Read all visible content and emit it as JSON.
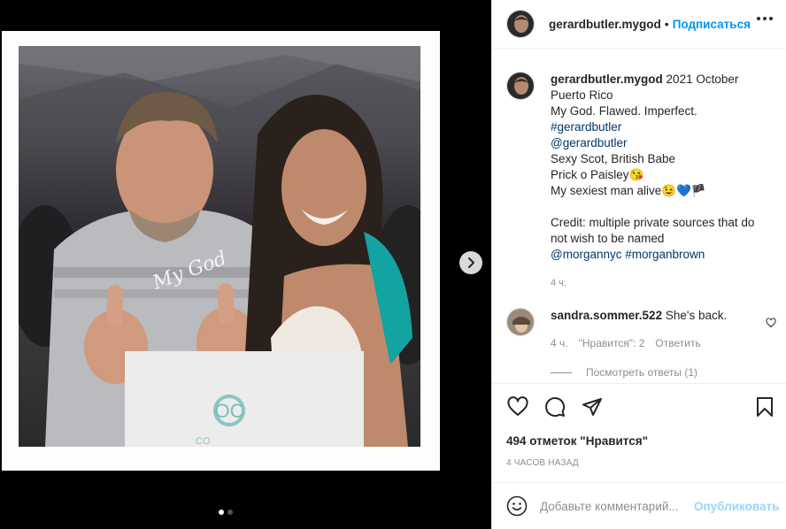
{
  "post": {
    "username": "gerardbutler.mygod",
    "follow_label": "Подписаться",
    "header_separator": "•",
    "caption_lines": [
      {
        "text": "2021 October",
        "style": "plain"
      },
      {
        "text": "Puerto Rico",
        "style": "plain"
      },
      {
        "text": "My God. Flawed. Imperfect.",
        "style": "plain"
      },
      {
        "text": "#gerardbutler",
        "style": "tag"
      },
      {
        "text": "@gerardbutler",
        "style": "tag"
      },
      {
        "text": "Sexy Scot, British Babe",
        "style": "plain"
      },
      {
        "text": "Prick o Paisley😘",
        "style": "plain"
      },
      {
        "text": "My sexiest man alive😉💙🏴",
        "style": "plain"
      },
      {
        "text": "",
        "style": "plain"
      },
      {
        "text": "Credit: multiple private sources that do not wish to be named",
        "style": "plain"
      }
    ],
    "credit_tags": [
      "@morgannyc",
      "#morganbrown"
    ],
    "caption_time": "4 ч.",
    "photo_text": "My God",
    "photo_sign_text": "OC",
    "photo_sign_sub": "CO"
  },
  "comment": {
    "username": "sandra.sommer.522",
    "text": "She's back.",
    "time": "4 ч.",
    "likes_label": "\"Нравится\": 2",
    "reply_label": "Ответить",
    "view_replies": "Посмотреть ответы (1)"
  },
  "actions": {
    "likes": "494 отметок \"Нравится\"",
    "time_ago": "4 ЧАСОВ НАЗАД"
  },
  "add_comment": {
    "placeholder": "Добавьте комментарий...",
    "publish_label": "Опубликовать"
  },
  "carousel": {
    "total": 2,
    "current": 1
  },
  "colors": {
    "accent": "#0095f6",
    "tag": "#00376b",
    "muted": "#8e8e8e",
    "text": "#262626"
  }
}
